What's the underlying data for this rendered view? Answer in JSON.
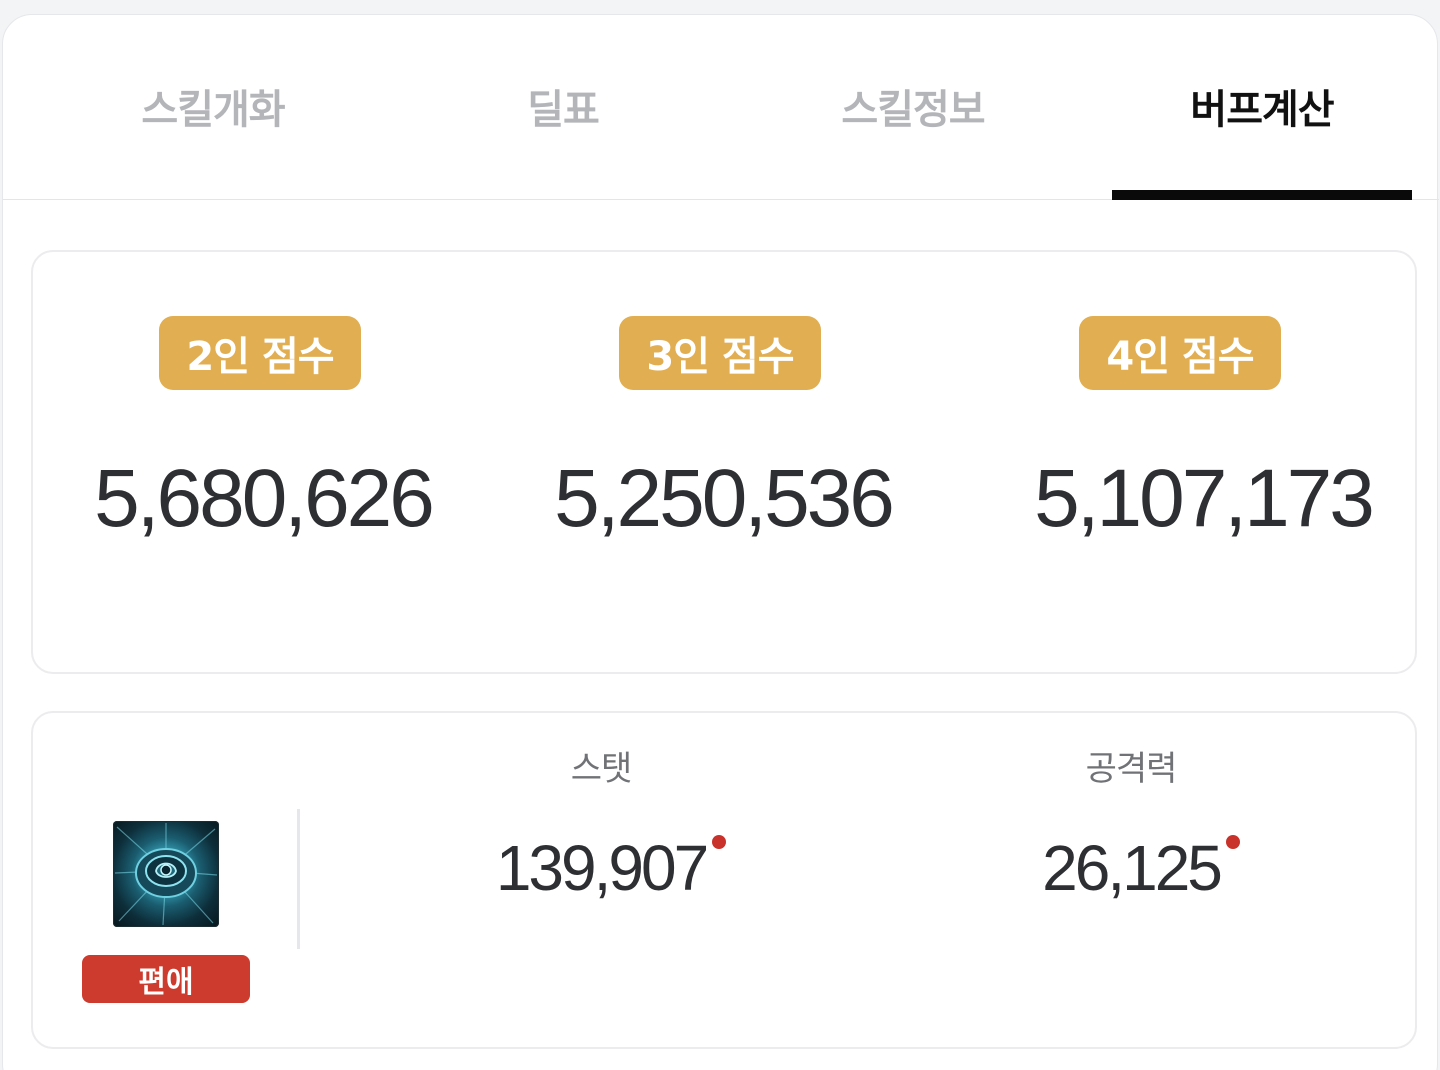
{
  "tabs": [
    {
      "label": "스킬개화",
      "active": false
    },
    {
      "label": "딜표",
      "active": false
    },
    {
      "label": "스킬정보",
      "active": false
    },
    {
      "label": "버프계산",
      "active": true
    }
  ],
  "scores": [
    {
      "badge": "2인 점수",
      "value": "5,680,626"
    },
    {
      "badge": "3인 점수",
      "value": "5,250,536"
    },
    {
      "badge": "4인 점수",
      "value": "5,107,173"
    }
  ],
  "buff": {
    "skill_icon": "blue-rose-skill-icon",
    "tag": "편애",
    "stats": [
      {
        "label": "스탯",
        "value": "139,907"
      },
      {
        "label": "공격력",
        "value": "26,125"
      }
    ]
  },
  "colors": {
    "badge": "#e1ae52",
    "tag": "#cc3b2e",
    "dot": "#c8322a",
    "active_tab": "#111111",
    "inactive_tab": "#b4b5b9"
  }
}
